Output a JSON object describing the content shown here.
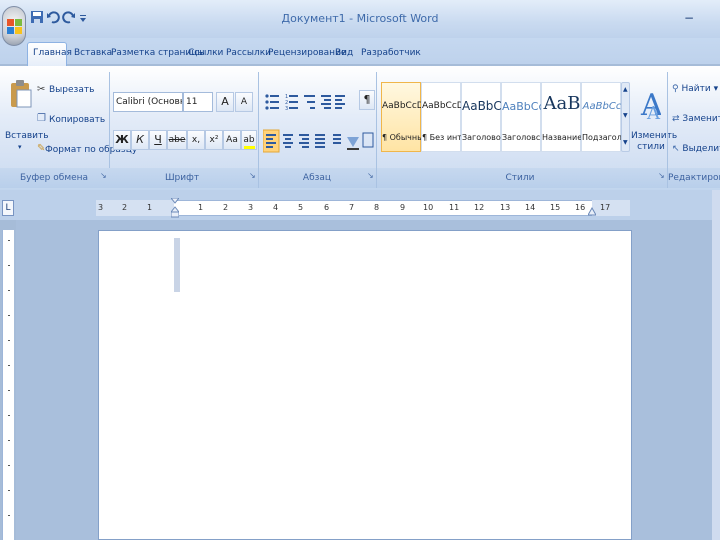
{
  "window": {
    "title": "Документ1 - Microsoft Word",
    "minimize": "−"
  },
  "quick_access": [
    {
      "icon": "save-icon"
    },
    {
      "icon": "undo-icon"
    },
    {
      "icon": "redo-icon"
    },
    {
      "icon": "customize-qat-icon"
    }
  ],
  "tabs": [
    {
      "label": "Главная",
      "active": true
    },
    {
      "label": "Вставка"
    },
    {
      "label": "Разметка страницы"
    },
    {
      "label": "Ссылки"
    },
    {
      "label": "Рассылки"
    },
    {
      "label": "Рецензирование"
    },
    {
      "label": "Вид"
    },
    {
      "label": "Разработчик"
    }
  ],
  "clipboard": {
    "paste_label": "Вставить",
    "cut_label": "Вырезать",
    "copy_label": "Копировать",
    "format_painter_label": "Формат по образцу",
    "group_label": "Буфер обмена"
  },
  "font": {
    "font_name": "Calibri (Основной т",
    "font_size": "11",
    "grow": "A",
    "shrink": "A",
    "bold": "Ж",
    "italic": "К",
    "underline": "Ч",
    "strike": "abe",
    "subscript": "x,",
    "superscript": "x²",
    "case": "Aa",
    "highlight": "ab",
    "font_color": "A",
    "group_label": "Шрифт"
  },
  "paragraph": {
    "group_label": "Абзац",
    "show_marks": "¶"
  },
  "styles": {
    "items": [
      {
        "preview": "AaBbCcDc",
        "name": "¶ Обычный"
      },
      {
        "preview": "AaBbCcDc",
        "name": "¶ Без инте..."
      },
      {
        "preview": "AaBbC(",
        "name": "Заголово..."
      },
      {
        "preview": "AaBbCc",
        "name": "Заголовс..."
      },
      {
        "preview": "AaB",
        "name": "Название"
      },
      {
        "preview": "AaBbCc",
        "name": "Подзагол..."
      }
    ],
    "change_styles_label": "Изменить стили",
    "group_label": "Стили"
  },
  "editing": {
    "find_label": "Найти",
    "replace_label": "Заменить",
    "select_label": "Выделить",
    "group_label": "Редактирование"
  },
  "ruler": {
    "corner": "L",
    "numbers": [
      "3",
      "2",
      "1",
      "1",
      "2",
      "3",
      "4",
      "5",
      "6",
      "7",
      "8",
      "9",
      "10",
      "11",
      "12",
      "13",
      "14",
      "15",
      "16",
      "17"
    ]
  },
  "colors": {
    "accent": "#15428b",
    "active_style": "#ffe4a4",
    "font_color": "#e02020",
    "highlight": "#ffff00"
  }
}
